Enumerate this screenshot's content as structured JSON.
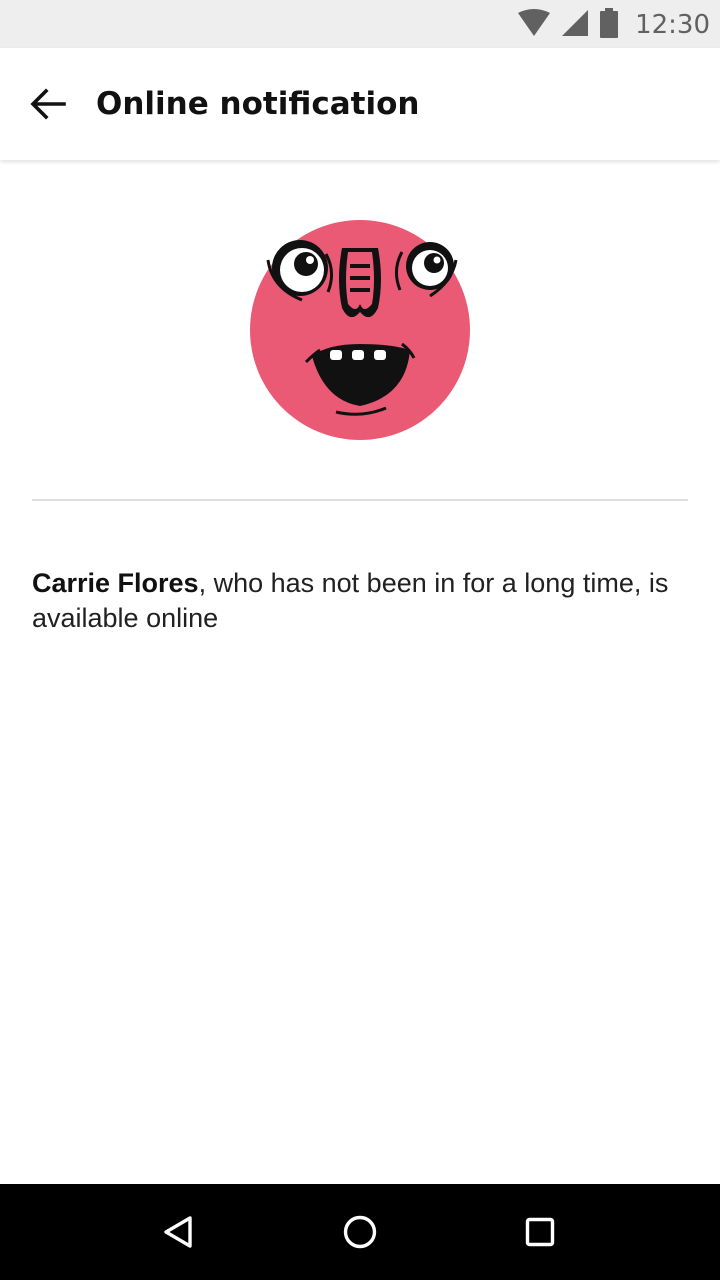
{
  "status_bar": {
    "time": "12:30",
    "icons": [
      "wifi-icon",
      "cell-signal-icon",
      "battery-icon"
    ]
  },
  "header": {
    "title": "Online notification",
    "back_icon": "arrow-back-icon"
  },
  "profile": {
    "avatar_icon": "monster-face-avatar",
    "avatar_color": "#eb5a75"
  },
  "notification": {
    "user_name": "Carrie Flores",
    "message_text": ", who has not been in for a long time, is available online"
  },
  "nav_bar": {
    "icons": [
      "back-triangle-icon",
      "home-circle-icon",
      "recents-square-icon"
    ]
  },
  "colors": {
    "status_bar_bg": "#eeeeee",
    "nav_bar_bg": "#000000",
    "text_primary": "#212121"
  }
}
